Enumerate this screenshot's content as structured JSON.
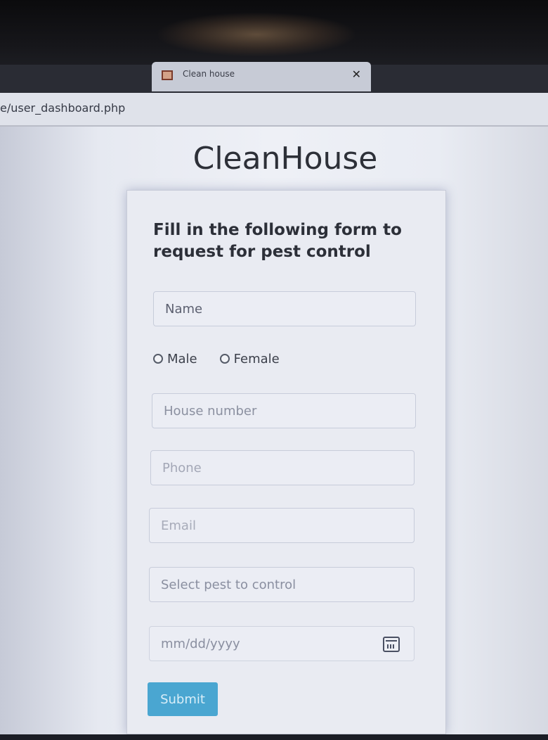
{
  "browser": {
    "tab_title": "Clean house",
    "address": "e/user_dashboard.php"
  },
  "page": {
    "brand": "CleanHouse",
    "intro_text": "Fill in the following form to request for pest control"
  },
  "form": {
    "name_placeholder": "Name",
    "gender_options": {
      "male": "Male",
      "female": "Female"
    },
    "house_placeholder": "House number",
    "phone_placeholder": "Phone",
    "email_placeholder": "Email",
    "pest_select_placeholder": "Select pest to control",
    "date_placeholder": "mm/dd/yyyy",
    "submit_label": "Submit"
  },
  "colors": {
    "accent": "#4aa6d1"
  },
  "icons": {
    "favicon": "site-favicon-icon",
    "close": "close-icon",
    "calendar": "calendar-icon"
  }
}
